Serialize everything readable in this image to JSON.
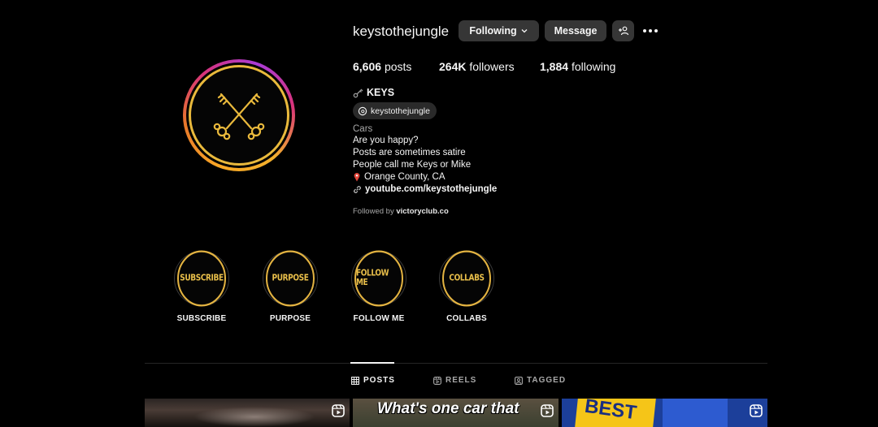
{
  "profile": {
    "username": "keystothejungle",
    "following_button": "Following",
    "message_button": "Message",
    "stats": {
      "posts_count": "6,606",
      "posts_label": "posts",
      "followers_count": "264K",
      "followers_label": "followers",
      "following_count": "1,884",
      "following_label": "following"
    },
    "display_name": "KEYS",
    "threads_handle": "keystothejungle",
    "category": "Cars",
    "bio": [
      "Are you happy?",
      "Posts are sometimes satire",
      "People call me Keys or Mike",
      "Orange County, CA"
    ],
    "link": "youtube.com/keystothejungle",
    "followed_by_prefix": "Followed by",
    "followed_by_user": "victoryclub.co"
  },
  "highlights": [
    {
      "cover_text": "SUBSCRIBE",
      "label": "SUBSCRIBE"
    },
    {
      "cover_text": "PURPOSE",
      "label": "PURPOSE"
    },
    {
      "cover_text": "FOLLOW ME",
      "label": "FOLLOW ME"
    },
    {
      "cover_text": "COLLABS",
      "label": "COLLABS"
    }
  ],
  "tabs": [
    {
      "label": "POSTS",
      "icon": "grid-icon",
      "active": true
    },
    {
      "label": "REELS",
      "icon": "reels-icon",
      "active": false
    },
    {
      "label": "TAGGED",
      "icon": "tagged-icon",
      "active": false
    }
  ],
  "posts": [
    {
      "caption": ""
    },
    {
      "caption": "What's one car that"
    },
    {
      "caption": "BEST"
    }
  ],
  "colors": {
    "background": "#000000",
    "button": "#363636",
    "gold": "#e9b93c",
    "muted_text": "#a8a8a8"
  }
}
